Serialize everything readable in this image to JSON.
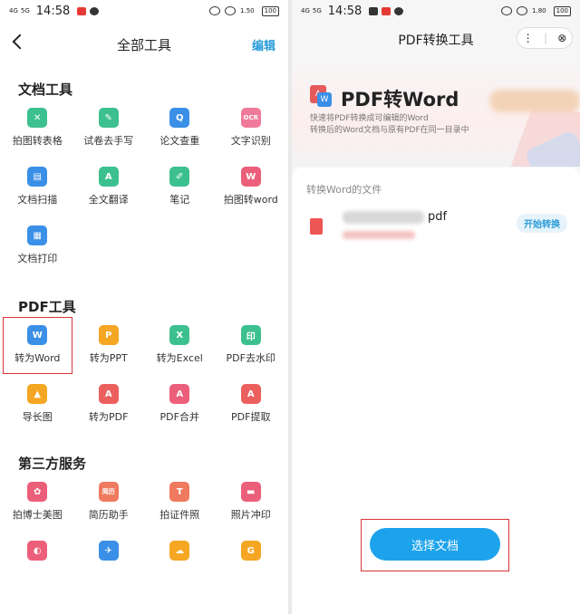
{
  "left": {
    "status": {
      "net1": "4G",
      "net2": "5G",
      "time": "14:58",
      "speed": "1.50",
      "battery": "100"
    },
    "header": {
      "title": "全部工具",
      "edit": "编辑"
    },
    "sections": [
      {
        "title": "文档工具",
        "tools": [
          {
            "label": "拍图转表格",
            "icon": "table-icon",
            "color": "#3cc08f",
            "glyph": "✕"
          },
          {
            "label": "试卷去手写",
            "icon": "eraser-icon",
            "color": "#3cc08f",
            "glyph": "✎"
          },
          {
            "label": "论文查重",
            "icon": "doc-check-icon",
            "color": "#3a8fe6",
            "glyph": "Q"
          },
          {
            "label": "文字识别",
            "icon": "ocr-icon",
            "color": "#f07a9a",
            "glyph": "OCR"
          },
          {
            "label": "文档扫描",
            "icon": "scan-icon",
            "color": "#3a8fe6",
            "glyph": "▤"
          },
          {
            "label": "全文翻译",
            "icon": "translate-icon",
            "color": "#3cc08f",
            "glyph": "A"
          },
          {
            "label": "笔记",
            "icon": "pen-icon",
            "color": "#3cc08f",
            "glyph": "✐"
          },
          {
            "label": "拍图转word",
            "icon": "word-icon",
            "color": "#ec5f7a",
            "glyph": "W"
          },
          {
            "label": "文档打印",
            "icon": "printer-icon",
            "color": "#3a8fe6",
            "glyph": "▦"
          }
        ]
      },
      {
        "title": "PDF工具",
        "tools": [
          {
            "label": "转为Word",
            "icon": "word-icon",
            "color": "#3a8fe6",
            "glyph": "W",
            "selected": true
          },
          {
            "label": "转为PPT",
            "icon": "ppt-icon",
            "color": "#f5a623",
            "glyph": "P"
          },
          {
            "label": "转为Excel",
            "icon": "excel-icon",
            "color": "#3cc08f",
            "glyph": "X"
          },
          {
            "label": "PDF去水印",
            "icon": "watermark-icon",
            "color": "#3cc08f",
            "glyph": "印"
          },
          {
            "label": "导长图",
            "icon": "long-image-icon",
            "color": "#f5a623",
            "glyph": "▲"
          },
          {
            "label": "转为PDF",
            "icon": "pdf-icon",
            "color": "#ec5f5f",
            "glyph": "A"
          },
          {
            "label": "PDF合并",
            "icon": "merge-icon",
            "color": "#ec5f7a",
            "glyph": "A"
          },
          {
            "label": "PDF提取",
            "icon": "extract-icon",
            "color": "#ec5f5f",
            "glyph": "A"
          }
        ]
      },
      {
        "title": "第三方服务",
        "tools": [
          {
            "label": "拍博士美图",
            "icon": "beauty-icon",
            "color": "#ec5f7a",
            "glyph": "✿"
          },
          {
            "label": "简历助手",
            "icon": "resume-icon",
            "color": "#f07a5f",
            "glyph": "简历"
          },
          {
            "label": "拍证件照",
            "icon": "id-photo-icon",
            "color": "#f07a5f",
            "glyph": "T"
          },
          {
            "label": "照片冲印",
            "icon": "photo-print-icon",
            "color": "#ec5f7a",
            "glyph": "▬"
          },
          {
            "label": "",
            "icon": "service-icon-5",
            "color": "#ec5f7a",
            "glyph": "◐"
          },
          {
            "label": "",
            "icon": "service-icon-6",
            "color": "#3a8fe6",
            "glyph": "✈"
          },
          {
            "label": "",
            "icon": "cloud-icon",
            "color": "#f5a623",
            "glyph": "☁"
          },
          {
            "label": "",
            "icon": "g-icon",
            "color": "#f5a623",
            "glyph": "G"
          }
        ]
      }
    ]
  },
  "right": {
    "status": {
      "net1": "4G",
      "net2": "5G",
      "time": "14:58",
      "speed": "1.80",
      "battery": "100"
    },
    "header": {
      "title": "PDF转换工具",
      "more": "⋮",
      "close": "⊗"
    },
    "hero": {
      "title": "PDF转Word",
      "desc1": "快速将PDF转换成可编辑的Word",
      "desc2": "转换后的Word文档与原有PDF在同一目录中"
    },
    "files_title": "转换Word的文件",
    "file": {
      "ext": "pdf",
      "action": "开始转换"
    },
    "choose_button": "选择文档"
  }
}
